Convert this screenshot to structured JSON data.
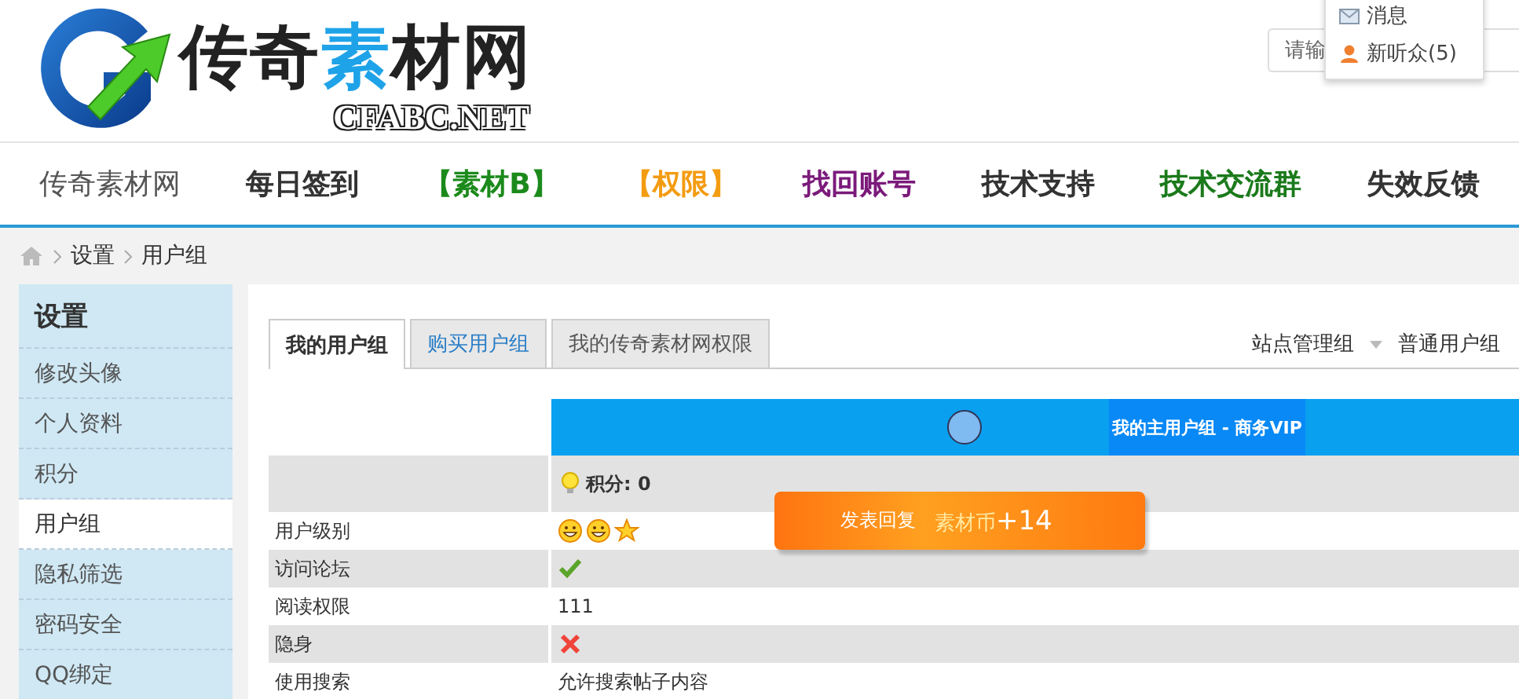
{
  "logo": {
    "parts": [
      {
        "text": "传奇",
        "color": "#222222"
      },
      {
        "text": "素",
        "color": "#1fa3e8"
      },
      {
        "text": "材网",
        "color": "#222222"
      }
    ],
    "subtitle": "CFABC.NET"
  },
  "search": {
    "placeholder": "请输"
  },
  "user_menu": {
    "items": [
      {
        "label": "消息",
        "kind": "message"
      },
      {
        "label": "新听众(5)",
        "kind": "person"
      }
    ]
  },
  "nav": {
    "items": [
      {
        "label": "传奇素材网",
        "color": "#555555",
        "selected": false
      },
      {
        "label": "每日签到",
        "color": "#333333",
        "selected": false
      },
      {
        "label": "【素材B】",
        "color": "#1b8a1b",
        "selected": false
      },
      {
        "label": "【权限】",
        "color": "#f39c12",
        "selected": false
      },
      {
        "label": "找回账号",
        "color": "#7b1a7b",
        "selected": false
      },
      {
        "label": "技术支持",
        "color": "#333333",
        "selected": false
      },
      {
        "label": "技术交流群",
        "color": "#1b7a1b",
        "selected": false
      },
      {
        "label": "失效反馈",
        "color": "#333333",
        "selected": false
      }
    ]
  },
  "breadcrumb": [
    "设置",
    "用户组"
  ],
  "sidebar": {
    "title": "设置",
    "items": [
      {
        "label": "修改头像",
        "selected": false
      },
      {
        "label": "个人资料",
        "selected": false
      },
      {
        "label": "积分",
        "selected": false
      },
      {
        "label": "用户组",
        "selected": true
      },
      {
        "label": "隐私筛选",
        "selected": false
      },
      {
        "label": "密码安全",
        "selected": false
      },
      {
        "label": "QQ绑定",
        "selected": false
      }
    ]
  },
  "tabs": [
    {
      "label": "我的用户组",
      "selected": true,
      "link": false
    },
    {
      "label": "购买用户组",
      "selected": false,
      "link": true
    },
    {
      "label": "我的传奇素材网权限",
      "selected": false,
      "link": false
    }
  ],
  "group_switch": {
    "current": "站点管理组",
    "other": "普通用户组"
  },
  "group_table": {
    "banner": "我的主用户组 - 商务VIP",
    "points": "积分: 0",
    "rows": [
      {
        "label": "用户级别",
        "kind": "rank"
      },
      {
        "label": "访问论坛",
        "kind": "yes"
      },
      {
        "label": "阅读权限",
        "kind": "text",
        "value": "111"
      },
      {
        "label": "隐身",
        "kind": "no"
      },
      {
        "label": "使用搜索",
        "kind": "text",
        "value": "允许搜索帖子内容"
      }
    ]
  },
  "toast": {
    "action": "发表回复",
    "reward": "素材币",
    "amount": "+14"
  }
}
